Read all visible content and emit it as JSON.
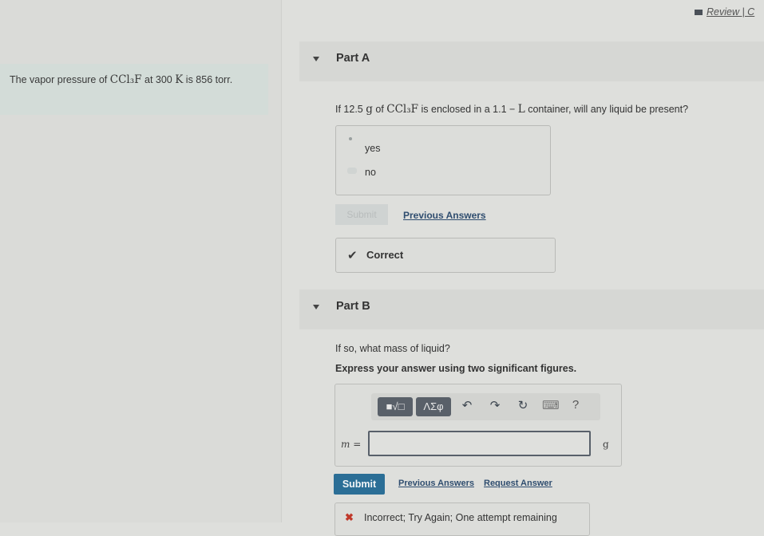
{
  "header": {
    "review_link": "Review | C",
    "review_icon": "square-icon"
  },
  "context": {
    "text_before": "The vapor pressure of ",
    "compound": "CCl₃F",
    "text_mid": " at 300 ",
    "unit_k": "K",
    "text_after": " is 856 torr."
  },
  "part_a": {
    "title": "Part A",
    "question_before": "If 12.5 ",
    "question_g": "g",
    "question_of": " of ",
    "question_compound": "CCl₃F",
    "question_mid": " is enclosed in a 1.1 − ",
    "question_l": "L",
    "question_after": " container, will any liquid be present?",
    "choices": [
      {
        "label": "yes",
        "selected": true
      },
      {
        "label": "no",
        "selected": false
      }
    ],
    "submit_label": "Submit",
    "previous_answers_label": "Previous Answers",
    "feedback_icon": "checkmark-icon",
    "feedback_text": "Correct"
  },
  "part_b": {
    "title": "Part B",
    "question": "If so, what mass of liquid?",
    "instruction": "Express your answer using two significant figures.",
    "toolbar": {
      "templates_label": "■√□",
      "symbols_label": "ΛΣφ",
      "undo": "↶",
      "redo": "↷",
      "reset": "↻",
      "keyboard": "⌨",
      "help": "?"
    },
    "variable_label": "m =",
    "answer_value": "",
    "unit": "g",
    "submit_label": "Submit",
    "previous_answers_label": "Previous Answers",
    "request_answer_label": "Request Answer",
    "feedback_icon": "x-icon",
    "feedback_text": "Incorrect; Try Again; One attempt remaining"
  },
  "colors": {
    "submit_blue": "#2b6e96",
    "link_blue": "#2f4d6f",
    "error_red": "#c0392b",
    "toolbar_button": "#596069"
  }
}
